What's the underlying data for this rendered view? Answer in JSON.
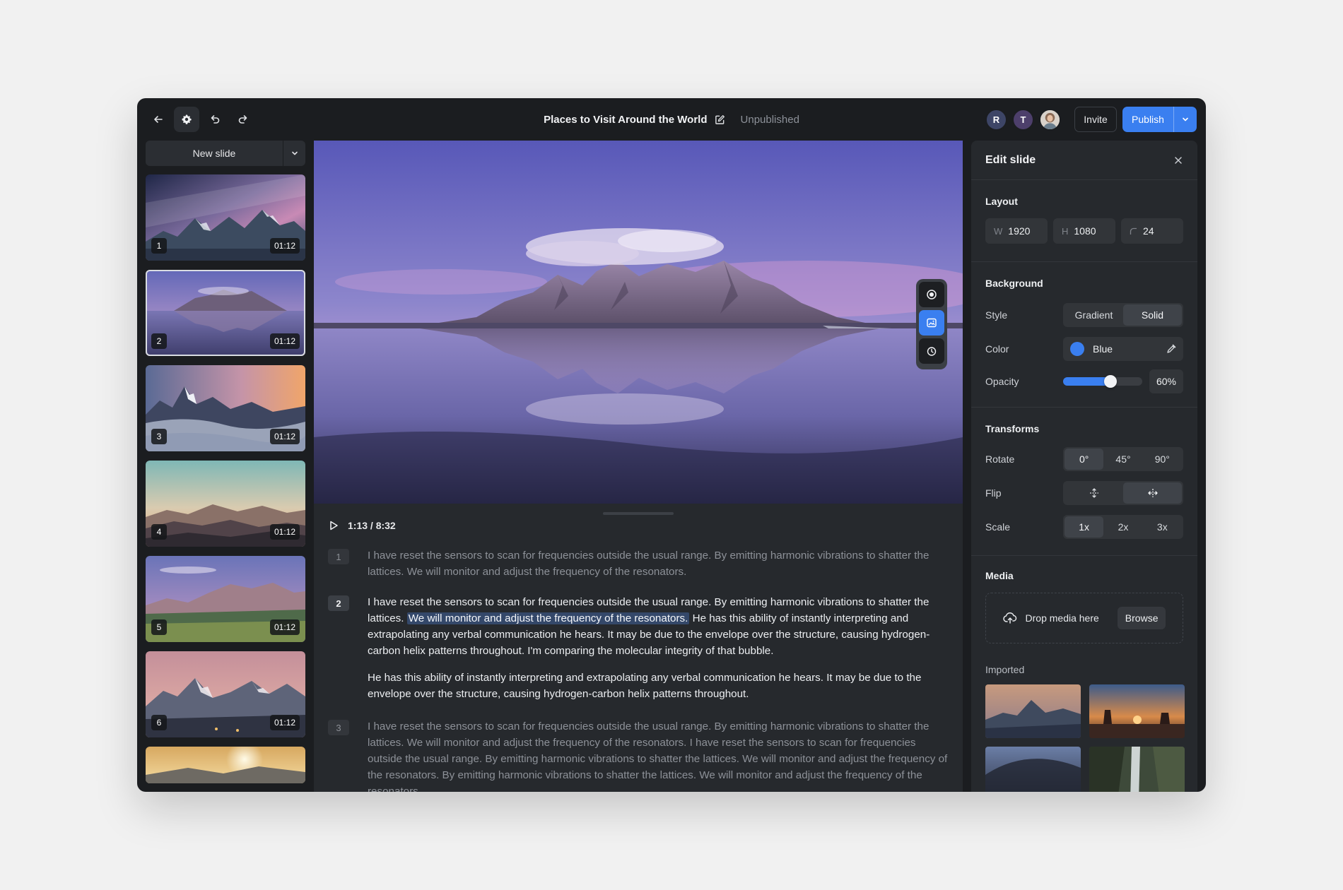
{
  "header": {
    "title": "Places to Visit Around the World",
    "status": "Unpublished",
    "avatars": [
      {
        "initial": "R",
        "color": "#3d4566"
      },
      {
        "initial": "T",
        "color": "#4d3f6b"
      }
    ],
    "invite_label": "Invite",
    "publish_label": "Publish"
  },
  "sidebar": {
    "new_slide_label": "New slide",
    "slides": [
      {
        "number": "1",
        "duration": "01:12"
      },
      {
        "number": "2",
        "duration": "01:12",
        "selected": true
      },
      {
        "number": "3",
        "duration": "01:12"
      },
      {
        "number": "4",
        "duration": "01:12"
      },
      {
        "number": "5",
        "duration": "01:12"
      },
      {
        "number": "6",
        "duration": "01:12"
      }
    ]
  },
  "player": {
    "time": "1:13 / 8:32"
  },
  "transcript": {
    "segments": [
      {
        "number": "1",
        "p1": "I have reset the sensors to scan for frequencies outside the usual range. By emitting harmonic vibrations to shatter the lattices. We will monitor and adjust the frequency of the resonators."
      },
      {
        "number": "2",
        "p1_before": "I have reset the sensors to scan for frequencies outside the usual range. By emitting harmonic vibrations to shatter the lattices. ",
        "p1_highlight": "We will monitor and adjust the frequency of the resonators.",
        "p1_after": " He has this ability of instantly interpreting and extrapolating any verbal communication he hears. It may be due to the envelope over the structure, causing hydrogen-carbon helix patterns throughout. I'm comparing the molecular integrity of that bubble.",
        "p2": "He has this ability of instantly interpreting and extrapolating any verbal communication he hears. It may be due to the envelope over the structure, causing hydrogen-carbon helix patterns throughout."
      },
      {
        "number": "3",
        "p1": "I have reset the sensors to scan for frequencies outside the usual range. By emitting harmonic vibrations to shatter the lattices. We will monitor and adjust the frequency of the resonators. I have reset the sensors to scan for frequencies outside the usual range. By emitting harmonic vibrations to shatter the lattices. We will monitor and adjust the frequency of the resonators. By emitting harmonic vibrations to shatter the lattices. We will monitor and adjust the frequency of the resonators."
      }
    ]
  },
  "edit_panel": {
    "title": "Edit slide",
    "layout": {
      "title": "Layout",
      "width_prefix": "W",
      "width": "1920",
      "height_prefix": "H",
      "height": "1080",
      "radius": "24"
    },
    "background": {
      "title": "Background",
      "style_label": "Style",
      "style_options": [
        "Gradient",
        "Solid"
      ],
      "style_selected": "Solid",
      "color_label": "Color",
      "color_name": "Blue",
      "color_value": "#3a7ff0",
      "opacity_label": "Opacity",
      "opacity_value": "60%",
      "opacity": 0.6
    },
    "transforms": {
      "title": "Transforms",
      "rotate_label": "Rotate",
      "rotate_options": [
        "0°",
        "45°",
        "90°"
      ],
      "rotate_selected": "0°",
      "flip_label": "Flip",
      "flip_selected": "horizontal",
      "scale_label": "Scale",
      "scale_options": [
        "1x",
        "2x",
        "3x"
      ],
      "scale_selected": "1x"
    },
    "media": {
      "title": "Media",
      "drop_label": "Drop media here",
      "browse_label": "Browse",
      "imported_label": "Imported"
    }
  },
  "colors": {
    "accent": "#3a7ff0",
    "app_bg": "#1b1d20",
    "panel_bg": "#26292d"
  }
}
